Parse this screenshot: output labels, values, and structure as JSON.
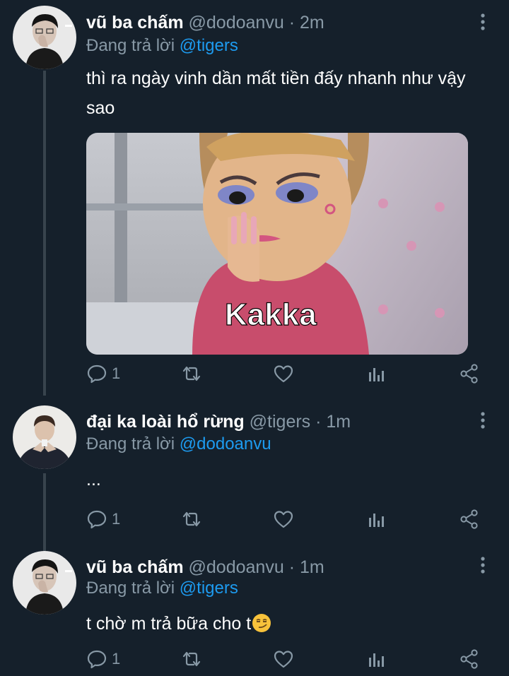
{
  "tweets": [
    {
      "display_name": "vũ ba chấm",
      "handle": "@dodoanvu",
      "time": "2m",
      "replying_prefix": "Đang trả lời",
      "replying_to": "@tigers",
      "text": "thì ra ngày vinh dần mất tiền đấy nhanh như vậy sao",
      "media_caption": "Kakka",
      "reply_count": "1"
    },
    {
      "display_name": "đại ka loài hổ rừng",
      "handle": "@tigers",
      "time": "1m",
      "replying_prefix": "Đang trả lời",
      "replying_to": "@dodoanvu",
      "text": "...",
      "reply_count": "1"
    },
    {
      "display_name": "vũ ba chấm",
      "handle": "@dodoanvu",
      "time": "1m",
      "replying_prefix": "Đang trả lời",
      "replying_to": "@tigers",
      "text": "t chờ m trả bữa cho t",
      "emoji": "smirking-face",
      "reply_count": "1"
    }
  ],
  "separator": "·",
  "colors": {
    "background": "#15202b",
    "secondary_text": "#8899a6",
    "link": "#1d9bf0",
    "thread_line": "#38444d"
  },
  "icons": [
    "reply-icon",
    "retweet-icon",
    "like-icon",
    "analytics-icon",
    "share-icon",
    "more-options-icon"
  ]
}
